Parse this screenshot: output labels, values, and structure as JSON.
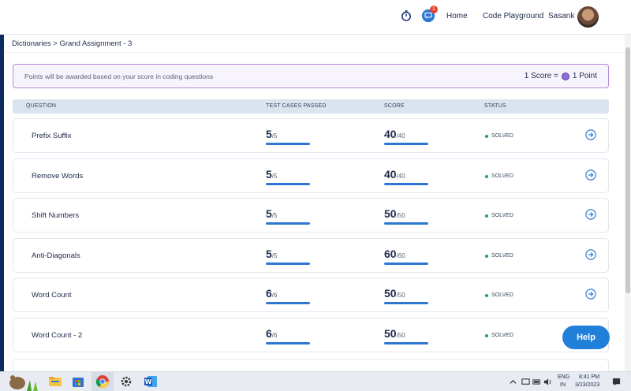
{
  "nav": {
    "home": "Home",
    "playground": "Code Playground",
    "user": "Sasank",
    "chat_badge": "1"
  },
  "breadcrumb": "Dictionaries > Grand Assignment - 3",
  "banner": {
    "text": "Points will be awarded based on your score in coding questions",
    "score_label": "1 Score =",
    "point_label": "1 Point"
  },
  "table": {
    "headers": [
      "QUESTION",
      "TEST CASES PASSED",
      "SCORE",
      "STATUS"
    ],
    "rows": [
      {
        "name": "Prefix Suffix",
        "tests": "5",
        "tests_max": "/5",
        "score": "40",
        "score_max": "/40",
        "status": "SOLVED"
      },
      {
        "name": "Remove Words",
        "tests": "5",
        "tests_max": "/5",
        "score": "40",
        "score_max": "/40",
        "status": "SOLVED"
      },
      {
        "name": "Shift Numbers",
        "tests": "5",
        "tests_max": "/5",
        "score": "50",
        "score_max": "/50",
        "status": "SOLVED"
      },
      {
        "name": "Anti-Diagonals",
        "tests": "5",
        "tests_max": "/5",
        "score": "60",
        "score_max": "/60",
        "status": "SOLVED"
      },
      {
        "name": "Word Count",
        "tests": "6",
        "tests_max": "/6",
        "score": "50",
        "score_max": "/50",
        "status": "SOLVED"
      },
      {
        "name": "Word Count - 2",
        "tests": "6",
        "tests_max": "/6",
        "score": "50",
        "score_max": "/50",
        "status": "SOLVED"
      }
    ]
  },
  "help": "Help",
  "taskbar": {
    "lang_top": "ENG",
    "lang_bottom": "IN",
    "time": "8:41 PM",
    "date": "3/23/2023"
  },
  "icons": {
    "timer": "timer-icon",
    "chat": "chat-icon",
    "go": "arrow-right-circle-icon"
  },
  "colors": {
    "primary": "#2d77d2",
    "solved": "#19a46b",
    "banner_border": "#b68ad7"
  }
}
